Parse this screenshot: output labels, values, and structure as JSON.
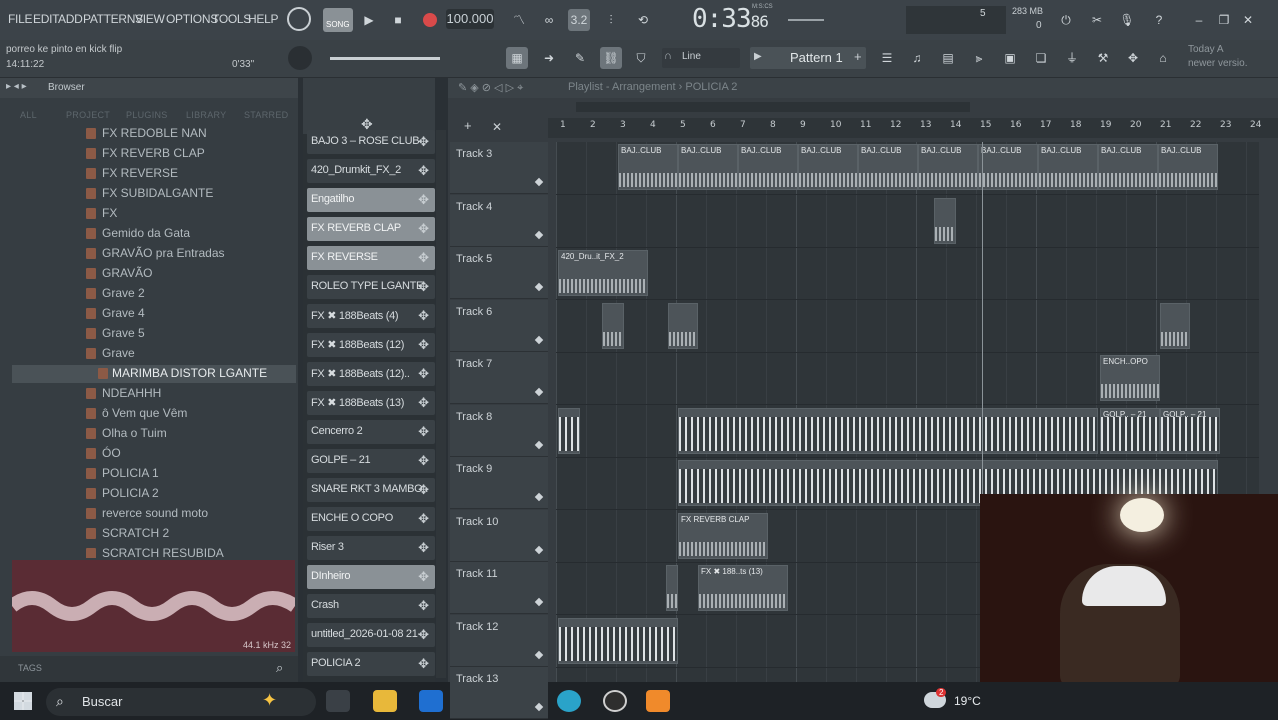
{
  "menu": [
    "FILE",
    "EDIT",
    "ADD",
    "PATTERNS",
    "VIEW",
    "OPTIONS",
    "TOOLS",
    "HELP"
  ],
  "hint": {
    "line1": "porreo ke pinto en kick flip",
    "line2": "14:11:22",
    "time": "0'33\""
  },
  "transport": {
    "song_label": "SONG",
    "tempo": "100.000",
    "time_main": "0:33",
    "time_ms": "86",
    "time_unit": "M:S:CS",
    "cpu_num": "5",
    "mem": "283 MB",
    "mem_sub": "0"
  },
  "toolbar2": {
    "snap": "Line",
    "pattern": "Pattern 1",
    "news_line1": "Today A",
    "news_line2": "newer versio."
  },
  "browser": {
    "title": "Browser",
    "tabs": [
      "ALL",
      "PROJECT",
      "PLUGINS",
      "LIBRARY",
      "STARRED"
    ],
    "items": [
      "FX REDOBLE NAN",
      "FX REVERB CLAP",
      "FX REVERSE",
      "FX SUBIDALGANTE",
      "FX",
      "Gemido da Gata",
      "GRAVÃO pra Entradas",
      "GRAVÃO",
      "Grave 2",
      "Grave 4",
      "Grave 5",
      "Grave",
      "MARIMBA DISTOR LGANTE",
      "NDEAHHH",
      "ô Vem que Vêm",
      "Olha o Tuim",
      "ÓO",
      "POLICIA 1",
      "POLICIA 2",
      "reverce sound moto",
      "SCRATCH 2",
      "SCRATCH RESUBIDA"
    ],
    "sample_info": "44.1 kHz 32",
    "tags_label": "TAGS"
  },
  "channels": [
    {
      "label": "BAJO 3 – ROSE CLUB",
      "hl": false
    },
    {
      "label": "420_Drumkit_FX_2",
      "hl": false
    },
    {
      "label": "Engatilho",
      "hl": true
    },
    {
      "label": "FX REVERB CLAP",
      "hl": true
    },
    {
      "label": "FX REVERSE",
      "hl": true
    },
    {
      "label": "ROLEO TYPE LGANTE",
      "hl": false
    },
    {
      "label": "FX ✖ 188Beats (4)",
      "hl": false
    },
    {
      "label": "FX ✖ 188Beats (12)",
      "hl": false
    },
    {
      "label": "FX ✖ 188Beats (12)..",
      "hl": false
    },
    {
      "label": "FX ✖ 188Beats (13)",
      "hl": false
    },
    {
      "label": "Cencerro 2",
      "hl": false
    },
    {
      "label": "GOLPE – 21",
      "hl": false
    },
    {
      "label": "SNARE RKT 3 MAMBO..",
      "hl": false
    },
    {
      "label": "ENCHE O COPO",
      "hl": false
    },
    {
      "label": "Riser 3",
      "hl": false
    },
    {
      "label": "DInheiro",
      "hl": true
    },
    {
      "label": "Crash",
      "hl": false
    },
    {
      "label": "untitled_2026-01-08 21-..",
      "hl": false
    },
    {
      "label": "POLICIA 2",
      "hl": false
    }
  ],
  "playlist": {
    "title": "Playlist - Arrangement › POLICIA 2",
    "ruler": [
      "1",
      "2",
      "3",
      "4",
      "5",
      "6",
      "7",
      "8",
      "9",
      "10",
      "11",
      "12",
      "13",
      "14",
      "15",
      "16",
      "17",
      "18",
      "19",
      "20",
      "21",
      "22",
      "23",
      "24"
    ],
    "tracks": [
      "Track 3",
      "Track 4",
      "Track 5",
      "Track 6",
      "Track 7",
      "Track 8",
      "Track 9",
      "Track 10",
      "Track 11",
      "Track 12",
      "Track 13"
    ],
    "clip_labels": {
      "baj": "BAJ..CLUB",
      "drumkit": "420_Dru..it_FX_2",
      "ench": "ENCH..OPO",
      "golp": "GOLP.. – 21",
      "fxreverb": "FX REVERB CLAP",
      "fx188": "FX ✖ 188..ts (13)"
    }
  },
  "taskbar": {
    "search": "Buscar",
    "weather": "19°C",
    "notif": "2"
  }
}
